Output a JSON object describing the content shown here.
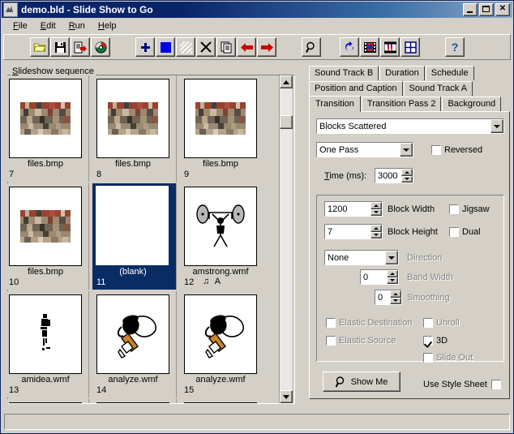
{
  "window": {
    "title": "demo.bld - Slide Show to Go",
    "icon": "app-icon",
    "minimize_label": "",
    "maximize_label": "",
    "close_label": "✕"
  },
  "menu": {
    "items": [
      {
        "label": "File",
        "accel": "F"
      },
      {
        "label": "Edit",
        "accel": "E"
      },
      {
        "label": "Run",
        "accel": "R"
      },
      {
        "label": "Help",
        "accel": "H"
      }
    ]
  },
  "toolbar": {
    "buttons": [
      {
        "name": "open-icon",
        "tip": "Open"
      },
      {
        "name": "save-icon",
        "tip": "Save"
      },
      {
        "name": "export-icon",
        "tip": "Export"
      },
      {
        "name": "cd-icon",
        "tip": "Burn CD"
      },
      {
        "name": "add-slide-icon",
        "tip": "Add"
      },
      {
        "name": "color-fill-icon",
        "tip": "Color"
      },
      {
        "name": "hatch-icon",
        "tip": "Pattern"
      },
      {
        "name": "delete-icon",
        "tip": "Delete"
      },
      {
        "name": "copy-icon",
        "tip": "Copy"
      },
      {
        "name": "move-left-icon",
        "tip": "Move Left"
      },
      {
        "name": "move-right-icon",
        "tip": "Move Right"
      },
      {
        "name": "preview-icon",
        "tip": "Preview"
      },
      {
        "name": "refresh-icon",
        "tip": "Refresh"
      },
      {
        "name": "film-strip-icon",
        "tip": "Film"
      },
      {
        "name": "film-people-icon",
        "tip": "Slideshow"
      },
      {
        "name": "grid-icon",
        "tip": "Grid View"
      },
      {
        "name": "help-icon",
        "tip": "Help"
      }
    ]
  },
  "sequence": {
    "legend": "Slideshow sequence",
    "slides": [
      {
        "num": "7",
        "name": "files.bmp",
        "kind": "bmp",
        "selected": false,
        "badge": ""
      },
      {
        "num": "8",
        "name": "files.bmp",
        "kind": "bmp",
        "selected": false,
        "badge": ""
      },
      {
        "num": "9",
        "name": "files.bmp",
        "kind": "bmp",
        "selected": false,
        "badge": ""
      },
      {
        "num": "10",
        "name": "files.bmp",
        "kind": "bmp",
        "selected": false,
        "badge": ""
      },
      {
        "num": "11",
        "name": "(blank)",
        "kind": "blank",
        "selected": true,
        "badge": ""
      },
      {
        "num": "12",
        "name": "amstrong.wmf",
        "kind": "lifter",
        "selected": false,
        "badge": "♫ A"
      },
      {
        "num": "13",
        "name": "amidea.wmf",
        "kind": "idea",
        "selected": false,
        "badge": ""
      },
      {
        "num": "14",
        "name": "analyze.wmf",
        "kind": "analyze",
        "selected": false,
        "badge": ""
      },
      {
        "num": "15",
        "name": "analyze.wmf",
        "kind": "analyze",
        "selected": false,
        "badge": ""
      }
    ],
    "scrollbar": {
      "up": "▲",
      "down": "▼"
    }
  },
  "tabs": {
    "row1": [
      {
        "label": "Sound Track B",
        "active": false
      },
      {
        "label": "Duration",
        "active": false
      },
      {
        "label": "Schedule",
        "active": false
      }
    ],
    "row2": [
      {
        "label": "Position and Caption",
        "active": false
      },
      {
        "label": "Sound Track A",
        "active": false
      }
    ],
    "row3": [
      {
        "label": "Transition",
        "active": true
      },
      {
        "label": "Transition Pass 2",
        "active": false
      },
      {
        "label": "Background",
        "active": false
      }
    ]
  },
  "transition": {
    "effect_value": "Blocks Scattered",
    "pass_value": "One Pass",
    "reversed_label": "Reversed",
    "reversed_checked": false,
    "time_label": "Time (ms):",
    "time_value": "3000",
    "block_width_value": "1200",
    "block_width_label": "Block Width",
    "block_height_value": "7",
    "block_height_label": "Block Height",
    "jigsaw_label": "Jigsaw",
    "jigsaw_checked": false,
    "dual_label": "Dual",
    "dual_checked": false,
    "direction_value": "None",
    "direction_label": "Direction",
    "band_width_value": "0",
    "band_width_label": "Band Width",
    "smoothing_value": "0",
    "smoothing_label": "Smoothing",
    "elastic_destination_label": "Elastic Destination",
    "elastic_destination_checked": false,
    "elastic_source_label": "Elastic Source",
    "elastic_source_checked": false,
    "unroll_label": "Unroll",
    "unroll_checked": false,
    "threed_label": "3D",
    "threed_checked": true,
    "slide_out_label": "Slide Out",
    "slide_out_checked": false,
    "show_me_label": "Show Me",
    "use_style_sheet_label": "Use Style Sheet",
    "use_style_sheet_checked": false
  },
  "status": {
    "text": ""
  },
  "colors": {
    "face": "#d4d0c8",
    "title_start": "#0a246a",
    "title_end": "#8aa8c8",
    "selection": "#0a2c64",
    "disabled_text": "#808080"
  }
}
